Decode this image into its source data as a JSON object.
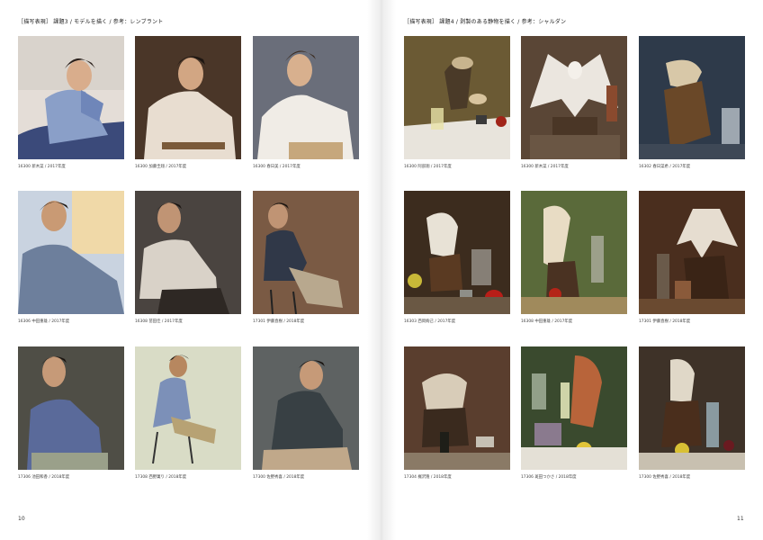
{
  "left_page": {
    "heading": "［描写表現］ 課題3 / モデルを描く / 参考：レンブラント",
    "page_number": "10",
    "captions": [
      "16300 新木菜 / 2017年度",
      "16300 加藤圭翔 / 2017年度",
      "16300 春日美 / 2017年度",
      "16306 中田重雄 / 2017年度",
      "16308 苗田佳 / 2017年度",
      "17301 伊藤直樹 / 2018年度",
      "17306 池田和香 / 2018年度",
      "17308 西野菓り / 2018年度",
      "17300 佐野秀喜 / 2018年度"
    ]
  },
  "right_page": {
    "heading": "［描写表現］ 課題4 / 剥製のある静物を描く / 参考：シャルダン",
    "page_number": "11",
    "captions": [
      "16300 阿部翔 / 2017年度",
      "16300 新木菜 / 2017年度",
      "16302 春日菜希 / 2017年度",
      "16303 西岡絢己 / 2017年度",
      "16308 中田重雄 / 2017年度",
      "17301 伊藤直樹 / 2018年度",
      "17304 梶沢隆 / 2018年度",
      "17306 斑田つかさ / 2018年度",
      "17300 佐野秀喜 / 2018年度"
    ]
  }
}
